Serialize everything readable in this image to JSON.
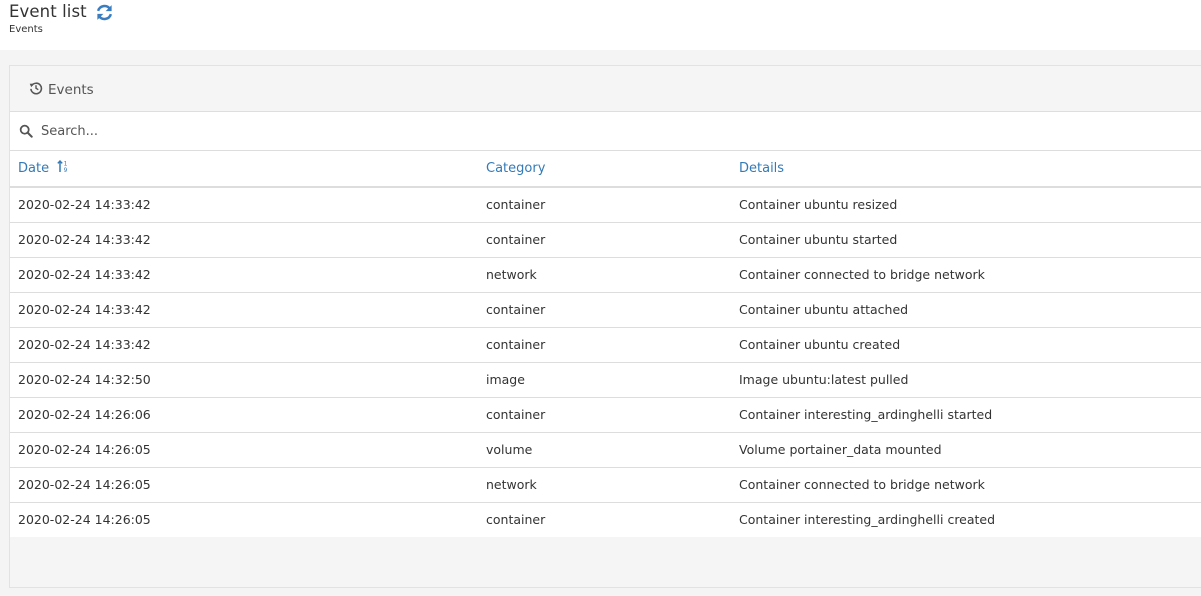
{
  "header": {
    "title": "Event list",
    "breadcrumb": "Events",
    "refresh_icon": "refresh-icon"
  },
  "widget": {
    "title": "Events",
    "title_icon": "history-icon"
  },
  "search": {
    "placeholder": "Search...",
    "value": "",
    "icon": "search-icon"
  },
  "table": {
    "columns": [
      {
        "label": "Date",
        "sort_icon": "sort-numeric-asc-icon"
      },
      {
        "label": "Category"
      },
      {
        "label": "Details"
      }
    ],
    "rows": [
      {
        "date": "2020-02-24 14:33:42",
        "category": "container",
        "details": "Container ubuntu resized"
      },
      {
        "date": "2020-02-24 14:33:42",
        "category": "container",
        "details": "Container ubuntu started"
      },
      {
        "date": "2020-02-24 14:33:42",
        "category": "network",
        "details": "Container connected to bridge network"
      },
      {
        "date": "2020-02-24 14:33:42",
        "category": "container",
        "details": "Container ubuntu attached"
      },
      {
        "date": "2020-02-24 14:33:42",
        "category": "container",
        "details": "Container ubuntu created"
      },
      {
        "date": "2020-02-24 14:32:50",
        "category": "image",
        "details": "Image ubuntu:latest pulled"
      },
      {
        "date": "2020-02-24 14:26:06",
        "category": "container",
        "details": "Container interesting_ardinghelli started"
      },
      {
        "date": "2020-02-24 14:26:05",
        "category": "volume",
        "details": "Volume portainer_data mounted"
      },
      {
        "date": "2020-02-24 14:26:05",
        "category": "network",
        "details": "Container connected to bridge network"
      },
      {
        "date": "2020-02-24 14:26:05",
        "category": "container",
        "details": "Container interesting_ardinghelli created"
      }
    ]
  },
  "colors": {
    "link": "#337ab7",
    "text": "#333333",
    "widget_bg": "#f5f5f5",
    "border": "#dddddd"
  }
}
